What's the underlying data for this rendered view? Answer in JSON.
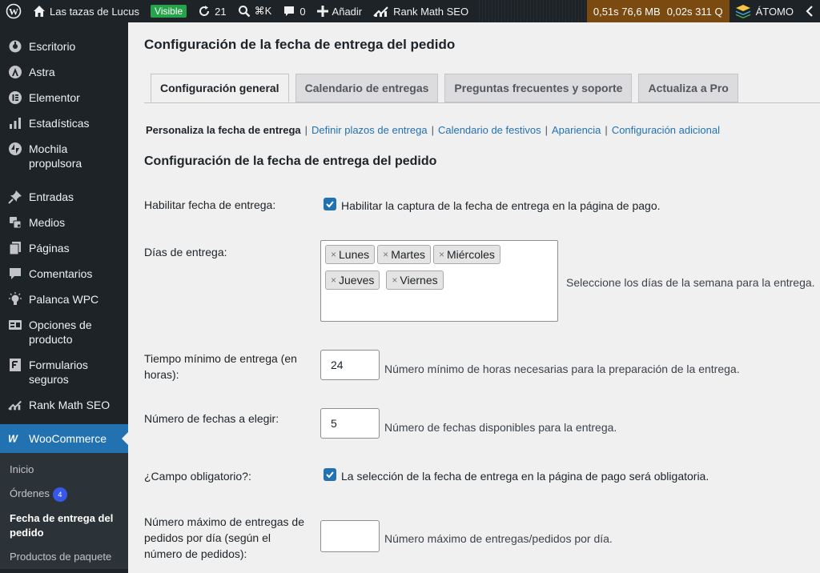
{
  "admin_bar": {
    "site_name": "Las tazas de Lucus",
    "visible_badge": "Visible",
    "updates_count": "21",
    "search_shortcut": "⌘K",
    "comments_count": "0",
    "new_label": "Añadir",
    "rank_math_label": "Rank Math SEO",
    "perf_a": "0,51s 76,6 MB",
    "perf_b": "0,02s 311 Q",
    "atomo_label": "ÁTOMO"
  },
  "sidebar": {
    "items": [
      {
        "label": "Escritorio",
        "icon": "dashboard-icon"
      },
      {
        "label": "Astra",
        "icon": "astra-icon"
      },
      {
        "label": "Elementor",
        "icon": "elementor-icon"
      },
      {
        "label": "Estadísticas",
        "icon": "stats-icon"
      },
      {
        "label": "Mochila propulsora",
        "icon": "jetpack-icon"
      },
      {
        "label": "Entradas",
        "icon": "pin-icon"
      },
      {
        "label": "Medios",
        "icon": "media-icon"
      },
      {
        "label": "Páginas",
        "icon": "pages-icon"
      },
      {
        "label": "Comentarios",
        "icon": "comments-icon"
      },
      {
        "label": "Palanca WPC",
        "icon": "lightbulb-icon"
      },
      {
        "label": "Opciones de producto",
        "icon": "product-options-icon"
      },
      {
        "label": "Formularios seguros",
        "icon": "forms-icon"
      },
      {
        "label": "Rank Math SEO",
        "icon": "rankmath-icon"
      },
      {
        "label": "WooCommerce",
        "icon": "woo-icon"
      }
    ],
    "submenu": [
      {
        "label": "Inicio"
      },
      {
        "label": "Órdenes",
        "badge": "4"
      },
      {
        "label": "Fecha de entrega del pedido"
      },
      {
        "label": "Productos de paquete"
      }
    ]
  },
  "main": {
    "page_title": "Configuración de la fecha de entrega del pedido",
    "tabs": [
      {
        "label": "Configuración general"
      },
      {
        "label": "Calendario de entregas"
      },
      {
        "label": "Preguntas frecuentes y soporte"
      },
      {
        "label": "Actualiza a Pro"
      }
    ],
    "subnav": [
      {
        "label": "Personaliza la fecha de entrega"
      },
      {
        "label": "Definir plazos de entrega"
      },
      {
        "label": "Calendario de festivos"
      },
      {
        "label": "Apariencia"
      },
      {
        "label": "Configuración adicional"
      }
    ],
    "section_title": "Configuración de la fecha de entrega del pedido",
    "fields": {
      "enable": {
        "label": "Habilitar fecha de entrega:",
        "checkbox_text": "Habilitar la captura de la fecha de entrega en la página de pago.",
        "checked": true
      },
      "days": {
        "label": "Días de entrega:",
        "selected": [
          "Lunes",
          "Martes",
          "Miércoles",
          "Jueves",
          "Viernes"
        ],
        "desc": "Seleccione los días de la semana para la entrega."
      },
      "min_time": {
        "label": "Tiempo mínimo de entrega (en horas):",
        "value": "24",
        "desc": "Número mínimo de horas necesarias para la preparación de la entrega."
      },
      "num_dates": {
        "label": "Número de fechas a elegir:",
        "value": "5",
        "desc": "Número de fechas disponibles para la entrega."
      },
      "required": {
        "label": "¿Campo obligatorio?:",
        "checkbox_text": "La selección de la fecha de entrega en la página de pago será obligatoria.",
        "checked": true
      },
      "max_per_day": {
        "label": "Número máximo de entregas de pedidos por día (según el número de pedidos):",
        "value": "",
        "desc": "Número máximo de entregas/pedidos por día."
      }
    }
  },
  "colors": {
    "accent": "#2271b1",
    "admin_bg": "#1d2327",
    "visible_green": "#26a34b",
    "perf_bg": "#7a4a10",
    "badge_blue": "#3858e9"
  }
}
